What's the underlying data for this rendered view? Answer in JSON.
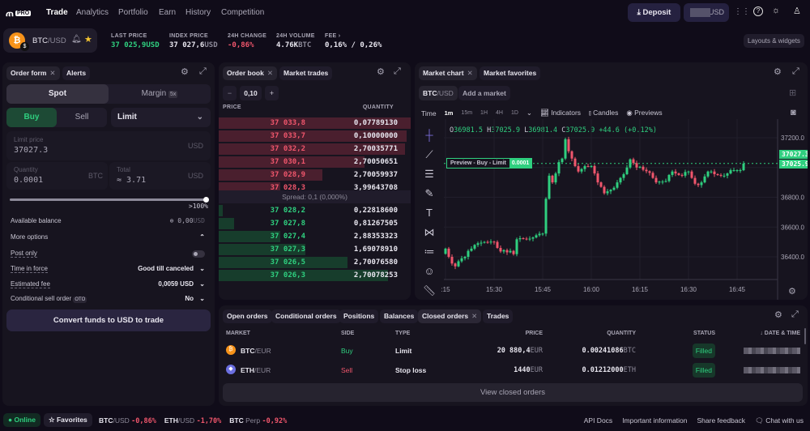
{
  "nav": {
    "logo": "PRO",
    "items": [
      "Trade",
      "Analytics",
      "Portfolio",
      "Earn",
      "History",
      "Competition"
    ],
    "active": "Trade",
    "deposit": "Deposit",
    "balance_currency": "USD",
    "layouts": "Layouts & widgets"
  },
  "ticker": {
    "pair_base": "BTC",
    "pair_quote": "/USD",
    "stats": [
      {
        "label": "LAST PRICE",
        "value": "37 025,9",
        "unit": "USD"
      },
      {
        "label": "INDEX PRICE",
        "value": "37 027,6",
        "unit": "USD"
      },
      {
        "label": "24H CHANGE",
        "value": "-0,86",
        "unit": "%"
      },
      {
        "label": "24H VOLUME",
        "value": "4.76K",
        "unit": "BTC"
      },
      {
        "label": "FEE",
        "value": "0,16% / 0,26%",
        "unit": ""
      }
    ]
  },
  "order_form": {
    "tabs": [
      "Order form",
      "Alerts"
    ],
    "spot": "Spot",
    "margin": "Margin",
    "margin_badge": "5x",
    "buy": "Buy",
    "sell": "Sell",
    "order_type": "Limit",
    "limit_price_label": "Limit price",
    "limit_price": "37027.3",
    "usd": "USD",
    "btc": "BTC",
    "quantity_label": "Quantity",
    "quantity": "0.0001",
    "total_label": "Total",
    "total": "≈ 3.71",
    "slider_percent": 100,
    "slider_label": ">100%",
    "available_label": "Available balance",
    "available_value": "0,00",
    "available_unit": "USD",
    "more_options": "More options",
    "post_only": "Post only",
    "tif_label": "Time in force",
    "tif_value": "Good till canceled",
    "fee_label": "Estimated fee",
    "fee_value": "0,0059 USD",
    "cond_label": "Conditional sell order",
    "cond_badge": "OTO",
    "cond_value": "No",
    "convert": "Convert funds to USD to trade"
  },
  "order_book": {
    "tabs": [
      "Order book",
      "Market trades"
    ],
    "step": "0,10",
    "price_header": "PRICE",
    "qty_header": "QUANTITY",
    "asks": [
      {
        "price": "37 033,8",
        "qty": "0,07789130",
        "depth": 1.0
      },
      {
        "price": "37 033,7",
        "qty": "0,10000000",
        "depth": 0.98
      },
      {
        "price": "37 032,2",
        "qty": "2,70035771",
        "depth": 0.97
      },
      {
        "price": "37 030,1",
        "qty": "2,70050651",
        "depth": 0.76
      },
      {
        "price": "37 028,9",
        "qty": "2,70059937",
        "depth": 0.54
      },
      {
        "price": "37 028,3",
        "qty": "3,99643708",
        "depth": 0.32
      }
    ],
    "spread": "Spread: 0,1 (0,000%)",
    "bids": [
      {
        "price": "37 028,2",
        "qty": "0,22818600",
        "depth": 0.02
      },
      {
        "price": "37 027,8",
        "qty": "0,81267505",
        "depth": 0.08
      },
      {
        "price": "37 027,4",
        "qty": "2,88353323",
        "depth": 0.32
      },
      {
        "price": "37 027,3",
        "qty": "1,69078910",
        "depth": 0.45
      },
      {
        "price": "37 026,5",
        "qty": "2,70076580",
        "depth": 0.67
      },
      {
        "price": "37 026,3",
        "qty": "2,70078253",
        "depth": 0.88
      }
    ]
  },
  "chart_panel": {
    "tabs": [
      "Market chart",
      "Market favorites"
    ],
    "market_base": "BTC",
    "market_quote": "/USD",
    "add_market": "Add a market",
    "time_label": "Time",
    "intervals": [
      "1m",
      "15m",
      "1H",
      "4H",
      "1D"
    ],
    "active_interval": "1m",
    "indicators": "Indicators",
    "candles": "Candles",
    "previews": "Previews",
    "ohlc": {
      "o": "36981.5",
      "h": "37025.9",
      "l": "36981.4",
      "c": "37025.9",
      "change": "+44.6 (+0.12%)"
    },
    "preview_label": "Preview - Buy - Limit",
    "preview_qty": "0.0001",
    "limit_tag": "37027.3",
    "last_tag": "37025.9"
  },
  "chart_data": {
    "type": "candlestick",
    "ylim": [
      36300,
      37250
    ],
    "y_ticks": [
      "37200.0",
      "36800.0",
      "36600.0",
      "36400.0"
    ],
    "x_ticks": [
      ":15",
      "15:30",
      "15:45",
      "16:00",
      "16:15",
      "16:30",
      "16:45"
    ],
    "first_open": 36420,
    "times": [
      "15:15",
      "15:16",
      "15:17",
      "15:18",
      "15:19",
      "15:20",
      "15:21",
      "15:22",
      "15:23",
      "15:24",
      "15:25",
      "15:26",
      "15:27",
      "15:28",
      "15:29",
      "15:30",
      "15:31",
      "15:32",
      "15:33",
      "15:34",
      "15:35",
      "15:36",
      "15:37",
      "15:38",
      "15:39",
      "15:40",
      "15:41",
      "15:42",
      "15:43",
      "15:44",
      "15:45",
      "15:46",
      "15:47",
      "15:48",
      "15:49",
      "15:50",
      "15:51",
      "15:52",
      "15:53",
      "15:54",
      "15:55",
      "15:56",
      "15:57",
      "15:58",
      "15:59",
      "16:00",
      "16:01",
      "16:02",
      "16:03",
      "16:04",
      "16:05",
      "16:06",
      "16:07",
      "16:08",
      "16:09",
      "16:10",
      "16:11",
      "16:12",
      "16:13",
      "16:14",
      "16:15",
      "16:16",
      "16:17",
      "16:18",
      "16:19",
      "16:20",
      "16:21",
      "16:22",
      "16:23",
      "16:24",
      "16:25",
      "16:26",
      "16:27",
      "16:28",
      "16:29",
      "16:30",
      "16:31",
      "16:32",
      "16:33",
      "16:34",
      "16:35",
      "16:36",
      "16:37",
      "16:38",
      "16:39",
      "16:40",
      "16:41",
      "16:42",
      "16:43",
      "16:44",
      "16:45",
      "16:46",
      "16:47"
    ],
    "close": [
      36455,
      36400,
      36355,
      36336,
      36370,
      36390,
      36400,
      36440,
      36455,
      36480,
      36491,
      36495,
      36500,
      36498,
      36502,
      36500,
      36460,
      36436,
      36445,
      36430,
      36440,
      36418,
      36518,
      36525,
      36522,
      36520,
      36522,
      36530,
      36545,
      36555,
      36556,
      36790,
      36945,
      36900,
      36960,
      37036,
      37060,
      37190,
      37109,
      37060,
      37009,
      36973,
      36990,
      37009,
      37008,
      37010,
      36960,
      36900,
      36870,
      36827,
      36840,
      36850,
      36864,
      36900,
      36930,
      36955,
      37000,
      37055,
      37030,
      37000,
      37005,
      36985,
      36975,
      36964,
      36930,
      36900,
      36905,
      36905,
      36909,
      36950,
      36973,
      36960,
      36950,
      36945,
      36970,
      36973,
      36930,
      36891,
      36882,
      36900,
      36940,
      36973,
      36973,
      36955,
      36950,
      36945,
      36945,
      36960,
      36982,
      36982,
      36982,
      36982,
      37026
    ],
    "colors": {
      "up": "#2fcf7f",
      "down": "#f0566c"
    }
  },
  "orders": {
    "tabs": [
      "Open orders",
      "Conditional orders",
      "Positions",
      "Balances",
      "Closed orders",
      "Trades"
    ],
    "active": "Closed orders",
    "headers": [
      "MARKET",
      "SIDE",
      "TYPE",
      "PRICE",
      "QUANTITY",
      "STATUS",
      "DATE & TIME"
    ],
    "rows": [
      {
        "base": "BTC",
        "quote": "/EUR",
        "side": "Buy",
        "type": "Limit",
        "price": "20 880,4",
        "price_unit": "EUR",
        "qty": "0.00241086",
        "qty_unit": "BTC",
        "status": "Filled"
      },
      {
        "base": "ETH",
        "quote": "/EUR",
        "side": "Sell",
        "type": "Stop loss",
        "price": "1440",
        "price_unit": "EUR",
        "qty": "0.01212000",
        "qty_unit": "ETH",
        "status": "Filled"
      }
    ],
    "view_all": "View closed orders"
  },
  "footer": {
    "online": "Online",
    "favorites": "Favorites",
    "tickers": [
      {
        "base": "BTC",
        "quote": "/USD",
        "change": "-0,86%"
      },
      {
        "base": "ETH",
        "quote": "/USD",
        "change": "-1,70%"
      },
      {
        "base": "BTC",
        "quote": " Perp",
        "change": "-0,92%"
      }
    ],
    "links": [
      "API Docs",
      "Important information",
      "Share feedback",
      "Chat with us"
    ]
  }
}
